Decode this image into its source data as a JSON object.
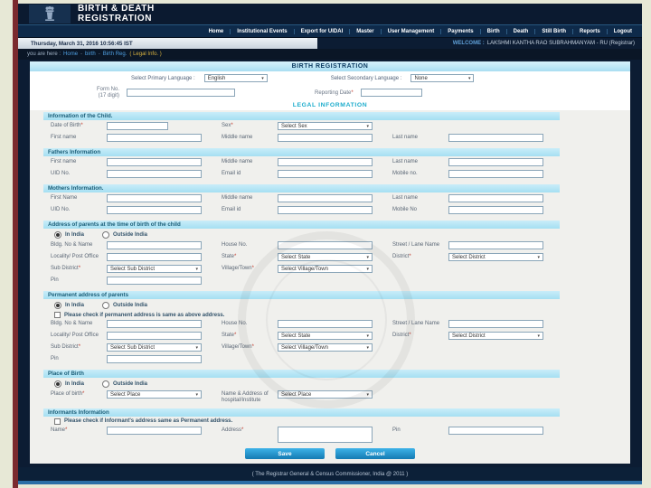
{
  "header": {
    "site_title1": "BIRTH & DEATH",
    "site_title2": "REGISTRATION",
    "nav": [
      "Home",
      "Institutional Events",
      "Export for UIDAI",
      "Master",
      "User Management",
      "Payments",
      "Birth",
      "Death",
      "Still Birth",
      "Reports",
      "Logout"
    ],
    "datetime": "Thursday, March 31, 2016 10:56:45 IST",
    "welcome_prefix": "WELCOME :",
    "welcome_user": "LAKSHMI KANTHA RAO SUBRAHMANYAM - RU  (Registrar)",
    "breadcrumb": {
      "prefix": "you are here :",
      "separator": "-",
      "links": [
        "Home",
        "birth",
        "Birth Reg."
      ],
      "suffix": "( Legal Info. )"
    }
  },
  "form": {
    "title": "BIRTH REGISTRATION",
    "language": {
      "primary_label": "Select Primary Language :",
      "primary_value": "English",
      "secondary_label": "Select Secondary Language :",
      "secondary_value": "None"
    },
    "meta": {
      "form_no_line1": "Form No.",
      "form_no_line2": "(17 digit)",
      "reporting_date_label": "Reporting Date"
    },
    "legal_heading": "LEGAL INFORMATION",
    "sections": [
      {
        "title": "Information of the Child.",
        "rows": [
          [
            {
              "label": "Date of Birth",
              "required": true,
              "type": "text",
              "small": true
            },
            {
              "label": "Sex",
              "required": true,
              "type": "select",
              "value": "Select Sex"
            }
          ],
          [
            {
              "label": "First name",
              "type": "text"
            },
            {
              "label": "Middle name",
              "type": "text"
            },
            {
              "label": "Last name",
              "type": "text"
            }
          ]
        ]
      },
      {
        "title": "Fathers Information",
        "rows": [
          [
            {
              "label": "First name",
              "type": "text"
            },
            {
              "label": "Middle name",
              "type": "text"
            },
            {
              "label": "Last name",
              "type": "text"
            }
          ],
          [
            {
              "label": "UID No.",
              "type": "text"
            },
            {
              "label": "Email id",
              "type": "text"
            },
            {
              "label": "Mobile no.",
              "type": "text"
            }
          ]
        ]
      },
      {
        "title": "Mothers Information.",
        "rows": [
          [
            {
              "label": "First Name",
              "type": "text"
            },
            {
              "label": "Middle name",
              "type": "text"
            },
            {
              "label": "Last name",
              "type": "text"
            }
          ],
          [
            {
              "label": "UID No.",
              "type": "text"
            },
            {
              "label": "Email id",
              "type": "text"
            },
            {
              "label": "Mobile No",
              "type": "text"
            }
          ]
        ]
      },
      {
        "title": "Address of parents at the time of birth of the child",
        "radios": [
          {
            "label": "In India",
            "checked": true
          },
          {
            "label": "Outside India",
            "checked": false
          }
        ],
        "rows": [
          [
            {
              "label": "Bldg. No & Name",
              "type": "text"
            },
            {
              "label": "House No.",
              "type": "text"
            },
            {
              "label": "Street / Lane Name",
              "type": "text"
            }
          ],
          [
            {
              "label": "Locality/ Post Office",
              "type": "text"
            },
            {
              "label": "State",
              "required": true,
              "type": "select",
              "value": "Select State"
            },
            {
              "label": "District",
              "required": true,
              "type": "select",
              "value": "Select District"
            }
          ],
          [
            {
              "label": "Sub District",
              "required": true,
              "type": "select",
              "value": "Select Sub District"
            },
            {
              "label": "Village/Town",
              "required": true,
              "type": "select",
              "value": "Select Village/Town"
            }
          ],
          [
            {
              "label": "Pin",
              "type": "text"
            }
          ]
        ]
      },
      {
        "title": "Permanent address of parents",
        "radios": [
          {
            "label": "In India",
            "checked": true
          },
          {
            "label": "Outside India",
            "checked": false
          }
        ],
        "checkbox": {
          "label": "Please check if permanent address is same as above address.",
          "checked": false
        },
        "rows": [
          [
            {
              "label": "Bldg. No & Name",
              "type": "text"
            },
            {
              "label": "House No.",
              "type": "text"
            },
            {
              "label": "Street / Lane Name",
              "type": "text"
            }
          ],
          [
            {
              "label": "Locality/ Post Office",
              "type": "text"
            },
            {
              "label": "State",
              "required": true,
              "type": "select",
              "value": "Select State"
            },
            {
              "label": "District",
              "required": true,
              "type": "select",
              "value": "Select District"
            }
          ],
          [
            {
              "label": "Sub District",
              "required": true,
              "type": "select",
              "value": "Select Sub District"
            },
            {
              "label": "Village/Town",
              "required": true,
              "type": "select",
              "value": "Select Village/Town"
            }
          ],
          [
            {
              "label": "Pin",
              "type": "text"
            }
          ]
        ]
      },
      {
        "title": "Place of Birth",
        "radios": [
          {
            "label": "In India",
            "checked": true
          },
          {
            "label": "Outside India",
            "checked": false
          }
        ],
        "rows": [
          [
            {
              "label": "Place of birth",
              "required": true,
              "type": "select",
              "value": "Select Place"
            },
            {
              "label": "Name & Address of hospital/Institute",
              "type": "select",
              "value": "Select Place"
            }
          ]
        ]
      },
      {
        "title": "Informants Information",
        "checkbox": {
          "label": "Please check if Informant's address same as Permanent address.",
          "checked": false
        },
        "rows": [
          [
            {
              "label": "Name",
              "required": true,
              "type": "text"
            },
            {
              "label": "Address",
              "required": true,
              "type": "textarea"
            },
            {
              "label": "Pin",
              "type": "text"
            }
          ]
        ]
      }
    ],
    "buttons": {
      "save": "Save",
      "cancel": "Cancel"
    }
  },
  "footer": {
    "copyright": "( The Registrar General & Census Commissioner, India @ 2011 )"
  }
}
